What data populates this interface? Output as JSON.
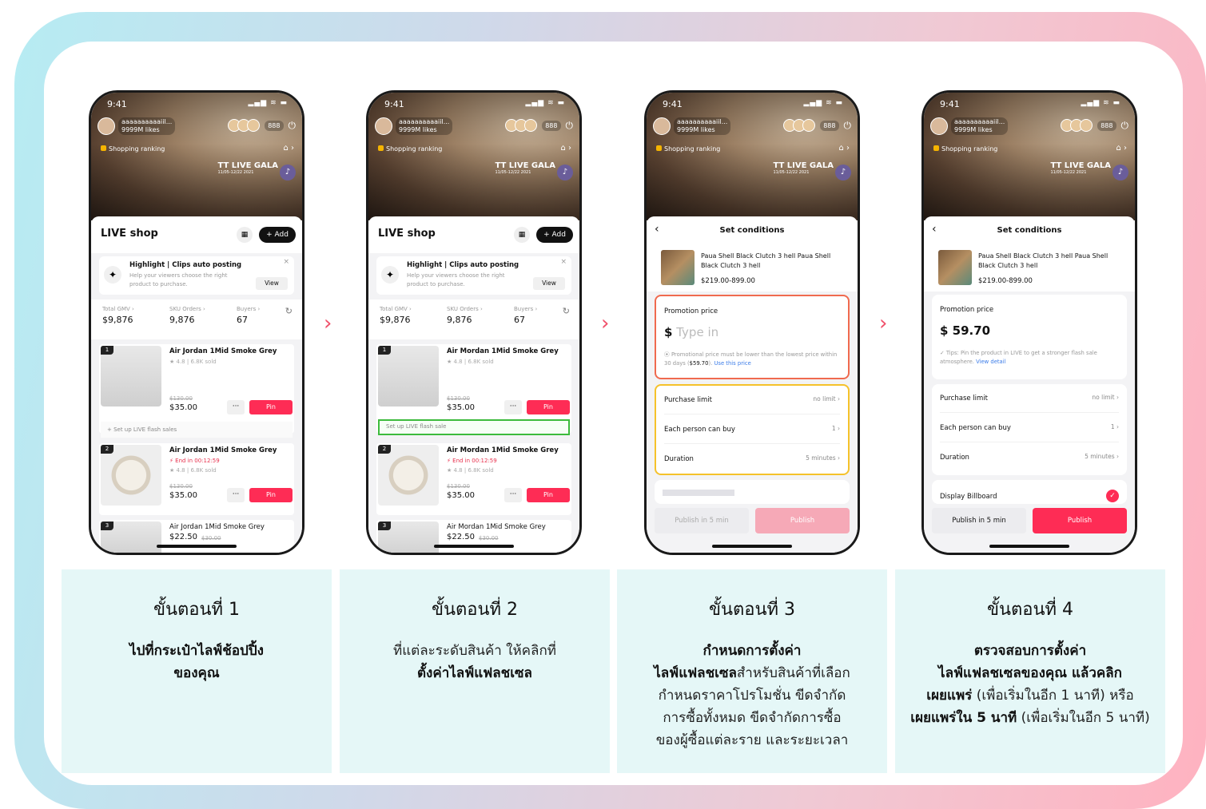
{
  "colors": {
    "accent": "#fe2c55",
    "highlight_green": "#3dbb3d",
    "highlight_red": "#f06a4f",
    "highlight_yellow": "#f5c22b",
    "card_bg": "#e5f7f7"
  },
  "status_time": "9:41",
  "status_icons": "▂▄▆ ≋ ▬",
  "live": {
    "host": "aaaaaaaaaaiil...",
    "likes": "9999M likes",
    "viewers": "888",
    "ranking": "Shopping ranking",
    "gala": "TT LIVE GALA",
    "gala_date": "11/05-12/22 2021",
    "gala_icon": "tiktok-icon"
  },
  "shop": {
    "title": "LIVE shop",
    "add": "+ Add",
    "grid_icon": "grid-icon",
    "highlight_title": "Highlight | Clips auto posting",
    "highlight_desc": "Help your viewers choose the right product to purchase.",
    "highlight_view": "View",
    "close": "×",
    "sparkle": "✦",
    "stats": [
      {
        "label": "Total GMV ›",
        "value": "$9,876"
      },
      {
        "label": "SKU Orders ›",
        "value": "9,876"
      },
      {
        "label": "Buyers ›",
        "value": "67"
      }
    ],
    "refresh": "↻",
    "flash": "+ Set up LIVE flash sales",
    "flash_green": "Set up LIVE flash sale",
    "more": "···",
    "pin": "Pin"
  },
  "phone1": {
    "p1": {
      "rank": "1",
      "name": "Air Jordan 1Mid Smoke Grey",
      "rate": "★ 4.8 | 6.8K sold",
      "old": "$130.00",
      "price": "$35.00"
    },
    "p2": {
      "rank": "2",
      "name": "Air Jordan 1Mid Smoke Grey",
      "end": "⚡ End in 00:12:59",
      "rate": "★ 4.8 | 6.8K sold",
      "old": "$130.00",
      "price": "$35.00"
    },
    "p3": {
      "rank": "3",
      "name": "Air Jordan 1Mid Smoke Grey",
      "price": "$22.50",
      "old": "$30.00"
    }
  },
  "phone2": {
    "p1": {
      "rank": "1",
      "name": "Air Mordan 1Mid Smoke Grey",
      "rate": "★ 4.8 | 6.8K sold",
      "old": "$130.00",
      "price": "$35.00"
    },
    "p2": {
      "rank": "2",
      "name": "Air Mordan 1Mid Smoke Grey",
      "end": "⚡ End in 00:12:59",
      "rate": "★ 4.8 | 6.8K sold",
      "old": "$130.00",
      "price": "$35.00"
    },
    "p3": {
      "rank": "3",
      "name": "Air Mordan 1Mid Smoke Grey",
      "price": "$22.50",
      "old": "$30.00"
    }
  },
  "cond": {
    "title": "Set conditions",
    "back": "‹",
    "product": "Paua Shell Black Clutch 3 hell Paua Shell Black Clutch 3 hell",
    "range": "$219.00-899.00",
    "promo_label": "Promotion price",
    "placeholder_sym": "$",
    "placeholder": "Type in",
    "note_pre": "⦿ Promotional price must be lower than the lowest price within 30 days (",
    "note_price": "$59.70",
    "note_post": "). ",
    "note_link": "Use this price",
    "value": "$ 59.70",
    "tip": "✓ Tips: Pin the product in LIVE to get a stronger flash sale atmosphere. ",
    "tip_link": "View detail",
    "limits": [
      {
        "label": "Purchase limit",
        "value": "no limit ›"
      },
      {
        "label": "Each person can buy",
        "value": "1 ›"
      },
      {
        "label": "Duration",
        "value": "5 minutes ›"
      }
    ],
    "billboard": "Display Billboard",
    "check": "✓",
    "publish5": "Publish in 5 min",
    "publish": "Publish"
  },
  "arrow": "›",
  "steps": [
    {
      "title": "ขั้นตอนที่ 1",
      "b1": "ไปที่กระเป๋าไลฟ์ช้อปปิ้ง",
      "b2": "ของคุณ"
    },
    {
      "title": "ขั้นตอนที่ 2",
      "l1": "ที่แต่ละระดับสินค้า ให้คลิกที่",
      "b1": "ตั้งค่าไลฟ์แฟลชเซล"
    },
    {
      "title": "ขั้นตอนที่ 3",
      "b1": "กำหนดการตั้งค่า",
      "b2": "ไลฟ์แฟลชเซล",
      "t2": "สำหรับสินค้าที่เลือก",
      "l3": "กำหนดราคาโปรโมชั่น ขีดจำกัด",
      "l4": "การซื้อทั้งหมด ขีดจำกัดการซื้อ",
      "l5": "ของผู้ซื้อแต่ละราย และระยะเวลา"
    },
    {
      "title": "ขั้นตอนที่ 4",
      "b1": "ตรวจสอบการตั้งค่า",
      "b2": "ไลฟ์แฟลชเซลของคุณ แล้วคลิก",
      "b3": "เผยแพร่",
      "t3": " (เพื่อเริ่มในอีก 1 นาที) หรือ",
      "b4": "เผยแพร่ใน 5 นาที",
      "t4": " (เพื่อเริ่มในอีก 5 นาที)"
    }
  ]
}
